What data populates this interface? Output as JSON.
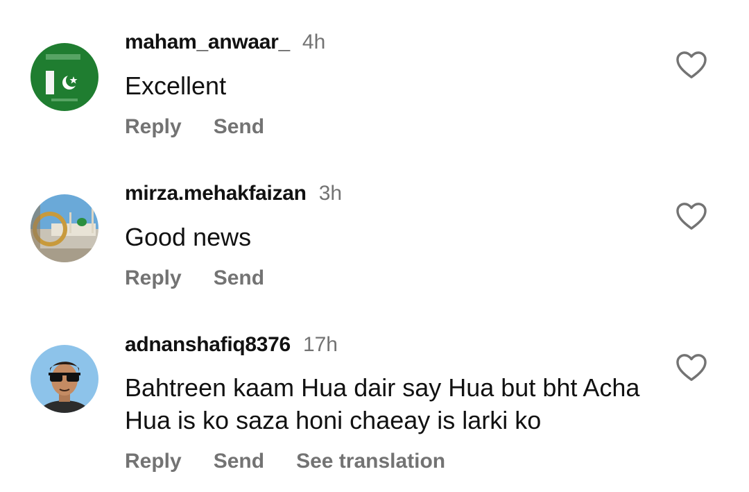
{
  "comments": [
    {
      "username": "maham_anwaar_",
      "time": "4h",
      "text": "Excellent",
      "actions": {
        "reply": "Reply",
        "send": "Send"
      },
      "avatar_icon": "pakistan-flag-avatar"
    },
    {
      "username": "mirza.mehakfaizan",
      "time": "3h",
      "text": "Good news",
      "actions": {
        "reply": "Reply",
        "send": "Send"
      },
      "avatar_icon": "mosque-photo-avatar"
    },
    {
      "username": "adnanshafiq8376",
      "time": "17h",
      "text": "Bahtreen kaam Hua dair say Hua but bht Acha Hua is ko saza honi chaeay is larki ko",
      "actions": {
        "reply": "Reply",
        "send": "Send",
        "translate": "See translation"
      },
      "avatar_icon": "person-photo-avatar"
    }
  ],
  "colors": {
    "text": "#111111",
    "secondary": "#737373",
    "flag_green": "#1e7d2e"
  },
  "icons": {
    "like": "heart-outline-icon"
  }
}
